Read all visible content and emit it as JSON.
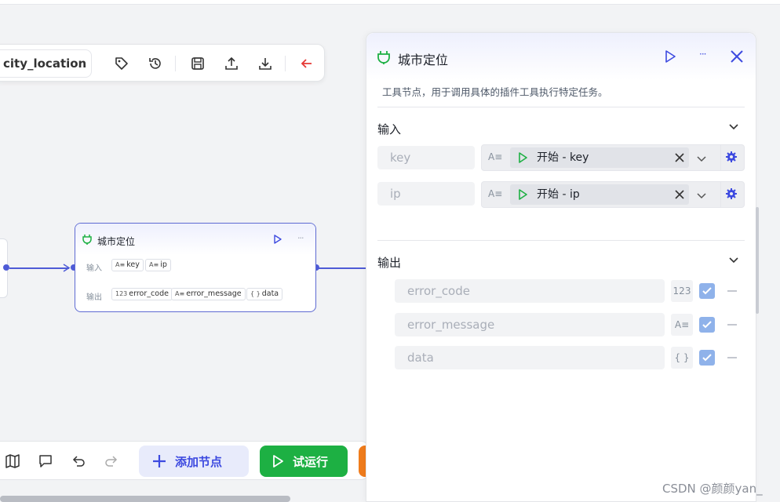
{
  "toolbar": {
    "workflow_name": "city_location",
    "icons": [
      "tag-icon",
      "history-icon",
      "save-icon",
      "upload-icon",
      "download-icon",
      "back-arrow-icon"
    ]
  },
  "node": {
    "title": "城市定位",
    "input_label": "输入",
    "output_label": "输出",
    "inputs": [
      "key",
      "ip"
    ],
    "outputs": [
      {
        "type": "123",
        "name": "error_code"
      },
      {
        "type": "A≡",
        "name": "error_message"
      },
      {
        "type": "{ }",
        "name": "data"
      }
    ]
  },
  "bottombar": {
    "icons": [
      "map-icon",
      "comment-icon",
      "undo-icon",
      "redo-icon"
    ],
    "add_node_label": "添加节点",
    "test_run_label": "试运行"
  },
  "panel": {
    "title": "城市定位",
    "description": "工具节点，用于调用具体的插件工具执行特定任务。",
    "input_section": "输入",
    "output_section": "输出",
    "inputs": [
      {
        "name": "key",
        "type_icon": "A≡",
        "ref": "开始 - key"
      },
      {
        "name": "ip",
        "type_icon": "A≡",
        "ref": "开始 - ip"
      }
    ],
    "outputs": [
      {
        "name": "error_code",
        "type": "123",
        "checked": true
      },
      {
        "name": "error_message",
        "type": "A≡",
        "checked": true
      },
      {
        "name": "data",
        "type": "{ }",
        "checked": true
      }
    ]
  },
  "watermark": "CSDN @颜颜yan_",
  "colors": {
    "accent": "#3d4ae0",
    "run": "#1db043",
    "node_border": "#5e6ad2",
    "plug": "#1db043",
    "back": "#e53935"
  }
}
